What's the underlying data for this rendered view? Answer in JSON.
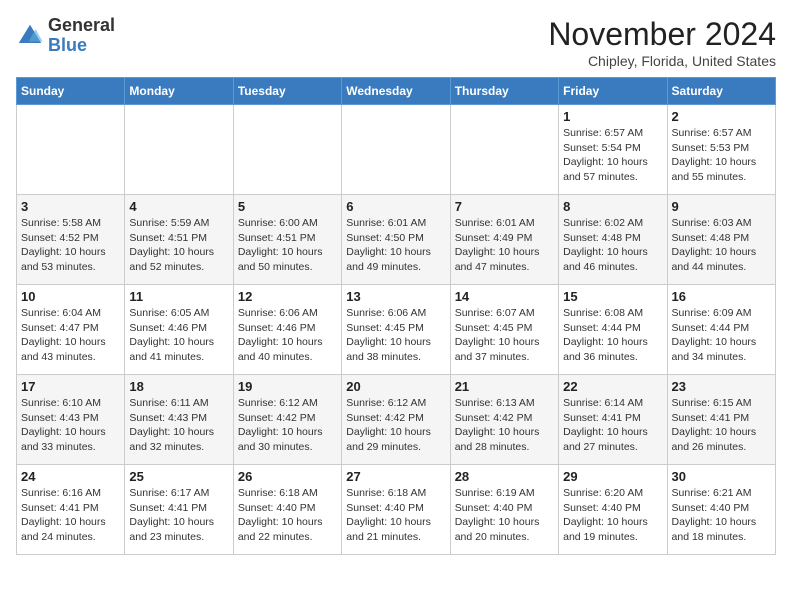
{
  "logo": {
    "general": "General",
    "blue": "Blue"
  },
  "header": {
    "month": "November 2024",
    "location": "Chipley, Florida, United States"
  },
  "days_of_week": [
    "Sunday",
    "Monday",
    "Tuesday",
    "Wednesday",
    "Thursday",
    "Friday",
    "Saturday"
  ],
  "weeks": [
    [
      {
        "day": "",
        "info": ""
      },
      {
        "day": "",
        "info": ""
      },
      {
        "day": "",
        "info": ""
      },
      {
        "day": "",
        "info": ""
      },
      {
        "day": "",
        "info": ""
      },
      {
        "day": "1",
        "info": "Sunrise: 6:57 AM\nSunset: 5:54 PM\nDaylight: 10 hours and 57 minutes."
      },
      {
        "day": "2",
        "info": "Sunrise: 6:57 AM\nSunset: 5:53 PM\nDaylight: 10 hours and 55 minutes."
      }
    ],
    [
      {
        "day": "3",
        "info": "Sunrise: 5:58 AM\nSunset: 4:52 PM\nDaylight: 10 hours and 53 minutes."
      },
      {
        "day": "4",
        "info": "Sunrise: 5:59 AM\nSunset: 4:51 PM\nDaylight: 10 hours and 52 minutes."
      },
      {
        "day": "5",
        "info": "Sunrise: 6:00 AM\nSunset: 4:51 PM\nDaylight: 10 hours and 50 minutes."
      },
      {
        "day": "6",
        "info": "Sunrise: 6:01 AM\nSunset: 4:50 PM\nDaylight: 10 hours and 49 minutes."
      },
      {
        "day": "7",
        "info": "Sunrise: 6:01 AM\nSunset: 4:49 PM\nDaylight: 10 hours and 47 minutes."
      },
      {
        "day": "8",
        "info": "Sunrise: 6:02 AM\nSunset: 4:48 PM\nDaylight: 10 hours and 46 minutes."
      },
      {
        "day": "9",
        "info": "Sunrise: 6:03 AM\nSunset: 4:48 PM\nDaylight: 10 hours and 44 minutes."
      }
    ],
    [
      {
        "day": "10",
        "info": "Sunrise: 6:04 AM\nSunset: 4:47 PM\nDaylight: 10 hours and 43 minutes."
      },
      {
        "day": "11",
        "info": "Sunrise: 6:05 AM\nSunset: 4:46 PM\nDaylight: 10 hours and 41 minutes."
      },
      {
        "day": "12",
        "info": "Sunrise: 6:06 AM\nSunset: 4:46 PM\nDaylight: 10 hours and 40 minutes."
      },
      {
        "day": "13",
        "info": "Sunrise: 6:06 AM\nSunset: 4:45 PM\nDaylight: 10 hours and 38 minutes."
      },
      {
        "day": "14",
        "info": "Sunrise: 6:07 AM\nSunset: 4:45 PM\nDaylight: 10 hours and 37 minutes."
      },
      {
        "day": "15",
        "info": "Sunrise: 6:08 AM\nSunset: 4:44 PM\nDaylight: 10 hours and 36 minutes."
      },
      {
        "day": "16",
        "info": "Sunrise: 6:09 AM\nSunset: 4:44 PM\nDaylight: 10 hours and 34 minutes."
      }
    ],
    [
      {
        "day": "17",
        "info": "Sunrise: 6:10 AM\nSunset: 4:43 PM\nDaylight: 10 hours and 33 minutes."
      },
      {
        "day": "18",
        "info": "Sunrise: 6:11 AM\nSunset: 4:43 PM\nDaylight: 10 hours and 32 minutes."
      },
      {
        "day": "19",
        "info": "Sunrise: 6:12 AM\nSunset: 4:42 PM\nDaylight: 10 hours and 30 minutes."
      },
      {
        "day": "20",
        "info": "Sunrise: 6:12 AM\nSunset: 4:42 PM\nDaylight: 10 hours and 29 minutes."
      },
      {
        "day": "21",
        "info": "Sunrise: 6:13 AM\nSunset: 4:42 PM\nDaylight: 10 hours and 28 minutes."
      },
      {
        "day": "22",
        "info": "Sunrise: 6:14 AM\nSunset: 4:41 PM\nDaylight: 10 hours and 27 minutes."
      },
      {
        "day": "23",
        "info": "Sunrise: 6:15 AM\nSunset: 4:41 PM\nDaylight: 10 hours and 26 minutes."
      }
    ],
    [
      {
        "day": "24",
        "info": "Sunrise: 6:16 AM\nSunset: 4:41 PM\nDaylight: 10 hours and 24 minutes."
      },
      {
        "day": "25",
        "info": "Sunrise: 6:17 AM\nSunset: 4:41 PM\nDaylight: 10 hours and 23 minutes."
      },
      {
        "day": "26",
        "info": "Sunrise: 6:18 AM\nSunset: 4:40 PM\nDaylight: 10 hours and 22 minutes."
      },
      {
        "day": "27",
        "info": "Sunrise: 6:18 AM\nSunset: 4:40 PM\nDaylight: 10 hours and 21 minutes."
      },
      {
        "day": "28",
        "info": "Sunrise: 6:19 AM\nSunset: 4:40 PM\nDaylight: 10 hours and 20 minutes."
      },
      {
        "day": "29",
        "info": "Sunrise: 6:20 AM\nSunset: 4:40 PM\nDaylight: 10 hours and 19 minutes."
      },
      {
        "day": "30",
        "info": "Sunrise: 6:21 AM\nSunset: 4:40 PM\nDaylight: 10 hours and 18 minutes."
      }
    ]
  ]
}
